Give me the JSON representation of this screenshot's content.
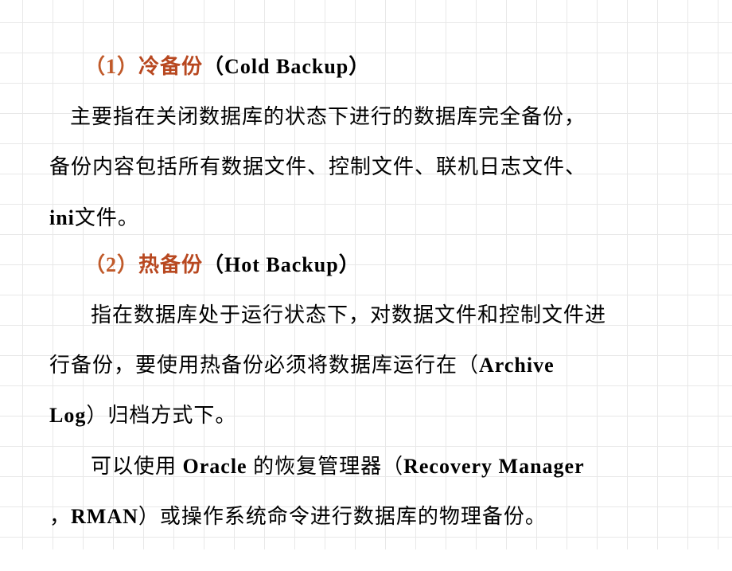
{
  "section1": {
    "number": "（1）",
    "term_cn": "冷备份",
    "term_en_open": "（",
    "term_en": "Cold Backup",
    "term_en_close": "）",
    "para_line1": "主要指在关闭数据库的状态下进行的数据库完全备份，",
    "para_line2": "备份内容包括所有数据文件、控制文件、联机日志文件、",
    "para_line3a": "ini",
    "para_line3b": "文件。"
  },
  "section2": {
    "number": "（2）",
    "term_cn": "热备份",
    "term_en_open": "（",
    "term_en": "Hot Backup",
    "term_en_close": "）",
    "para1_line1": "指在数据库处于运行状态下，对数据文件和控制文件进",
    "para1_line2a": "行备份，要使用热备份必须将数据库运行在（",
    "para1_line2b": "Archive ",
    "para1_line3a": "Log",
    "para1_line3b": "）归档方式下。",
    "para2_line1a": "可以使用 ",
    "para2_line1b": "Oracle",
    "para2_line1c": " 的恢复管理器（",
    "para2_line1d": "Recovery Manager",
    "para2_line2a": "，",
    "para2_line2b": "RMAN",
    "para2_line2c": "）或操作系统命令进行数据库的物理备份。"
  }
}
